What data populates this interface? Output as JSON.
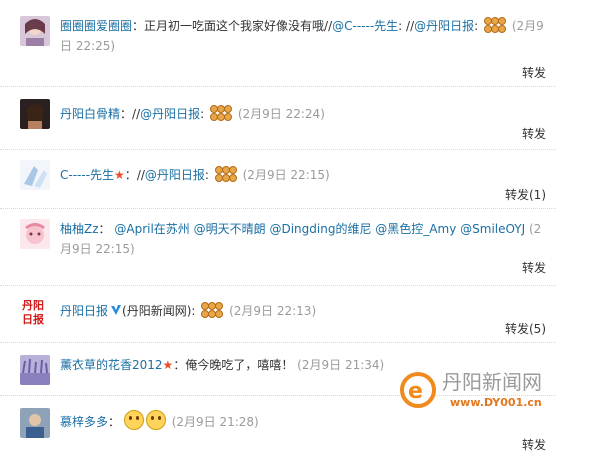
{
  "items": [
    {
      "name": "圈圈圈爱圈圈",
      "colon": "：",
      "text": "正月初一吃面这个我家好像没有哦",
      "rt1_sep": "//",
      "rt1": "@C-----先生",
      "rt1_colon": ": ",
      "rt2_sep": "//",
      "rt2": "@丹阳日报",
      "rt2_colon": ":",
      "time": "(2月9日 22:25)",
      "forward": "转发"
    },
    {
      "name": "丹阳白骨精",
      "colon": "：",
      "rt_sep": "//",
      "rt": "@丹阳日报",
      "rt_colon": ":",
      "time": "(2月9日 22:24)",
      "forward": "转发"
    },
    {
      "name": "C-----先生",
      "colon": "：",
      "rt_sep": "//",
      "rt": "@丹阳日报",
      "rt_colon": ":",
      "time": "(2月9日 22:15)",
      "forward": "转发(1)"
    },
    {
      "name": "柚柚Zz",
      "colon": "：",
      "m1": "@April在苏州",
      "m2": "@明天不晴朗",
      "m3": "@Dingding的维尼",
      "m4": "@黑色控_Amy",
      "m5": "@SmileOYJ",
      "time": "(2月9日 22:15)",
      "forward": "转发"
    },
    {
      "name": "丹阳日报",
      "affil": "(丹阳新闻网):",
      "time": "(2月9日 22:13)",
      "forward": "转发(5)"
    },
    {
      "name": "薰衣草的花香2012",
      "colon": "：",
      "text": "俺今晚吃了，嘻嘻！",
      "time": "(2月9日 21:34)"
    },
    {
      "name": "慕梓多多",
      "colon": "：",
      "time": "(2月9日 21:28)",
      "forward": "转发"
    }
  ],
  "watermark": {
    "site_name": "丹阳新闻网",
    "site_url": "www.DY001.cn"
  },
  "colors": {
    "link": "#1a6fa3",
    "time": "#9b9b9b",
    "watermark_orange": "#f08a1c"
  }
}
